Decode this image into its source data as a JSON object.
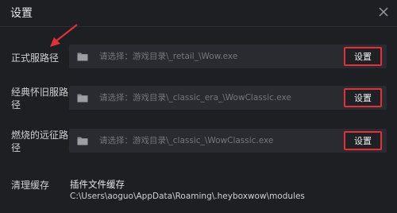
{
  "dialog": {
    "title": "设置",
    "close_icon": "close-icon"
  },
  "paths": [
    {
      "label": "正式服路径",
      "placeholder": "请选择：游戏目录\\_retail_\\Wow.exe",
      "button": "设置"
    },
    {
      "label": "经典怀旧服路径",
      "placeholder": "请选择：游戏目录\\_classic_era_\\WowClassic.exe",
      "button": "设置"
    },
    {
      "label": "燃烧的远征路径",
      "placeholder": "请选择：游戏目录\\_classic_\\WowClassic.exe",
      "button": "设置"
    }
  ],
  "cache": {
    "label": "清理缓存",
    "title": "插件文件缓存",
    "path": "C:\\Users\\aoguo\\AppData\\Roaming\\.heyboxwow\\modules"
  },
  "colors": {
    "background": "#1e1f23",
    "field": "#2a2b30",
    "highlight": "#e0303a"
  }
}
